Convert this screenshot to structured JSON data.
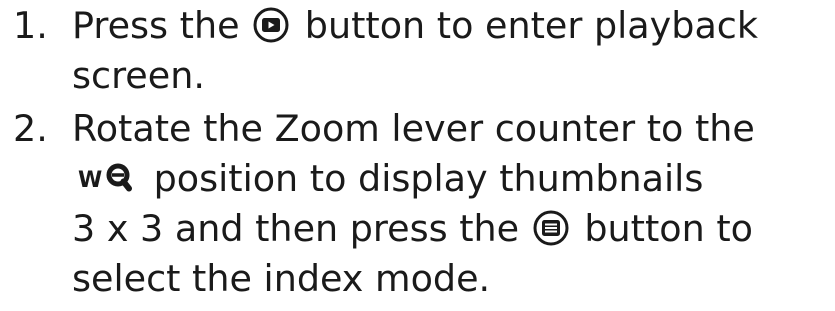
{
  "steps": [
    {
      "number": "1.",
      "line1_before": "Press the",
      "icon1": "playback-button-icon",
      "line1_after": "button to enter playback",
      "line2": "screen."
    },
    {
      "number": "2.",
      "line1": "Rotate the Zoom lever counter to the",
      "zoom_icon": "zoom-wide-icon",
      "zoom_icon_letter": "W",
      "line2_after": "position to display thumbnails",
      "line3_before": "3 x 3 and then press the",
      "icon2": "menu-button-icon",
      "line3_after": "button to",
      "line4": "select the index mode."
    }
  ],
  "colors": {
    "text": "#1a1a1a",
    "icon_fill": "#1a1a1a"
  }
}
